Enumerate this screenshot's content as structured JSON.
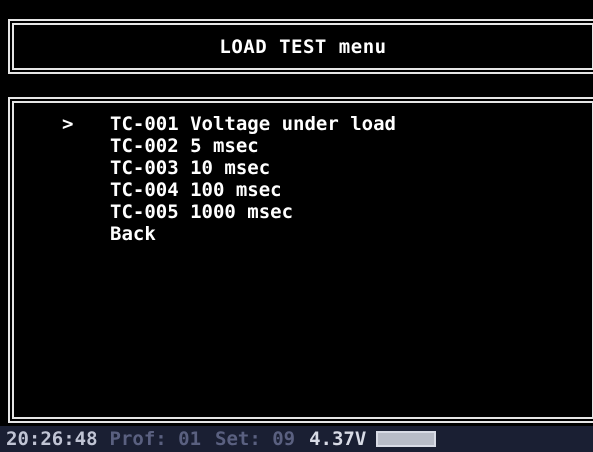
{
  "header": {
    "title": "LOAD TEST menu"
  },
  "menu": {
    "cursor": ">",
    "items": [
      {
        "label": "TC-001 Voltage under load",
        "selected": true
      },
      {
        "label": "TC-002 5 msec",
        "selected": false
      },
      {
        "label": "TC-003 10 msec",
        "selected": false
      },
      {
        "label": "TC-004 100 msec",
        "selected": false
      },
      {
        "label": "TC-005 1000 msec",
        "selected": false
      },
      {
        "label": "Back",
        "selected": false
      }
    ]
  },
  "status": {
    "time": "20:26:48",
    "profile": "Prof: 01",
    "set": "Set: 09",
    "voltage": "4.37V"
  },
  "colors": {
    "background": "#000000",
    "text": "#ffffff",
    "border": "#e6e6e6",
    "status_bg": "#1a1f33",
    "status_dim": "#5a6080"
  }
}
